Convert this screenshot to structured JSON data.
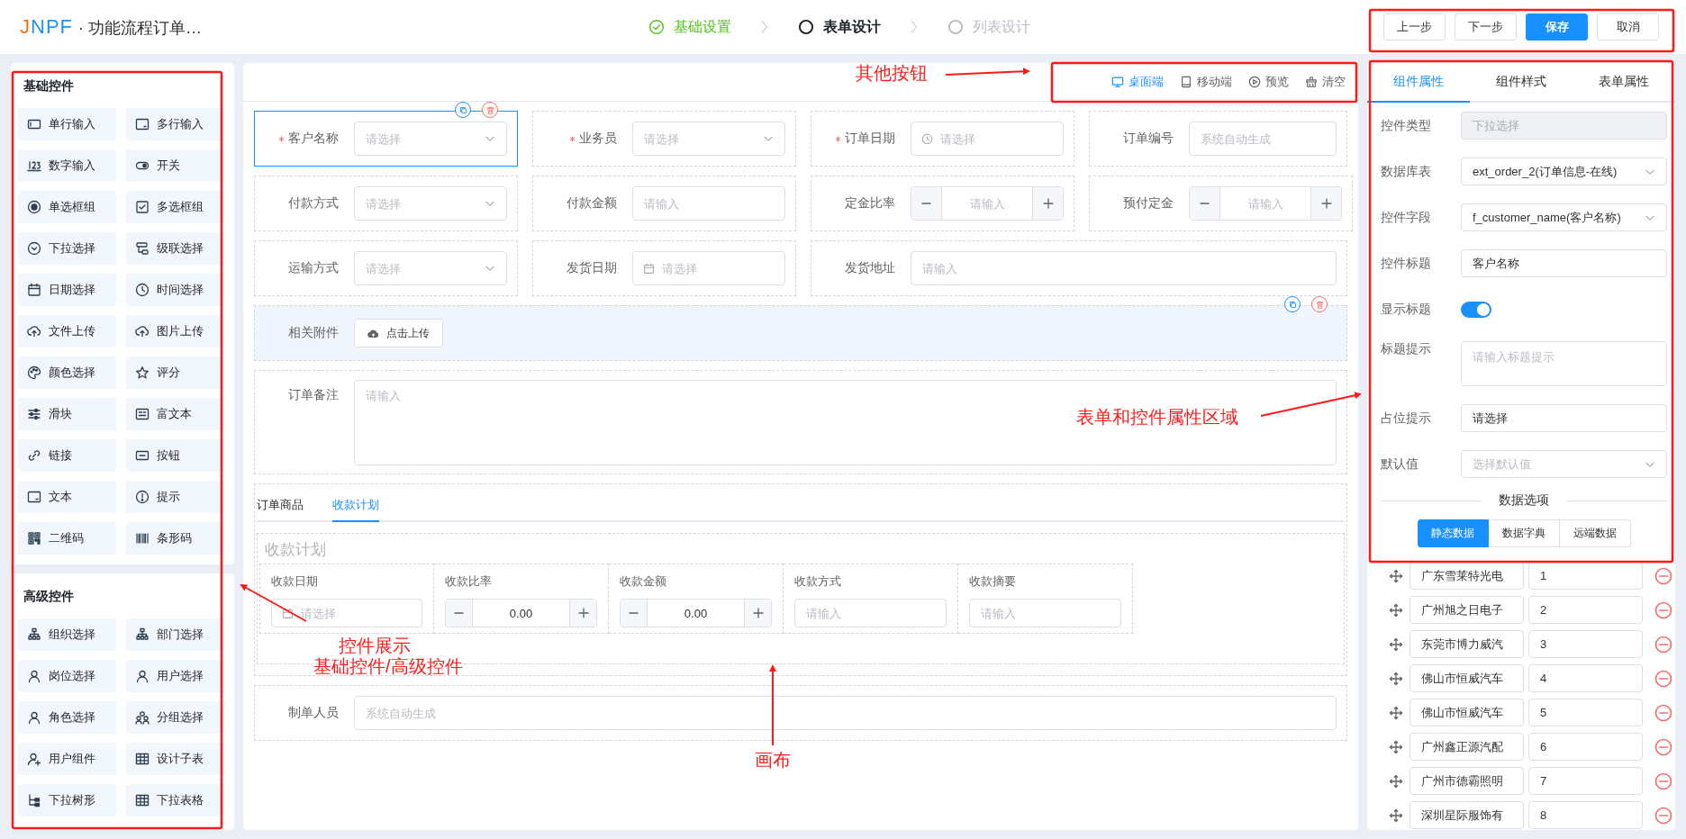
{
  "app": {
    "logo": "JNPF",
    "title": "· 功能流程订单…"
  },
  "steps": [
    {
      "label": "基础设置",
      "done": true,
      "current": false
    },
    {
      "label": "表单设计",
      "done": false,
      "current": true
    },
    {
      "label": "列表设计",
      "done": false,
      "current": false
    }
  ],
  "header_buttons": [
    {
      "label": "上一步",
      "primary": false
    },
    {
      "label": "下一步",
      "primary": false
    },
    {
      "label": "保存",
      "primary": true
    },
    {
      "label": "取消",
      "primary": false
    }
  ],
  "palette": [
    {
      "title": "基础控件",
      "items": [
        "单行输入",
        "多行输入",
        "数字输入",
        "开关",
        "单选框组",
        "多选框组",
        "下拉选择",
        "级联选择",
        "日期选择",
        "时间选择",
        "文件上传",
        "图片上传",
        "颜色选择",
        "评分",
        "滑块",
        "富文本",
        "链接",
        "按钮",
        "文本",
        "提示",
        "二维码",
        "条形码"
      ]
    },
    {
      "title": "高级控件",
      "items": [
        "组织选择",
        "部门选择",
        "岗位选择",
        "用户选择",
        "角色选择",
        "分组选择",
        "用户组件",
        "设计子表",
        "下拉树形",
        "下拉表格"
      ]
    }
  ],
  "toolbar": [
    {
      "label": "桌面端",
      "selected": true
    },
    {
      "label": "移动端",
      "selected": false
    },
    {
      "label": "预览",
      "selected": false
    },
    {
      "label": "清空",
      "selected": false
    }
  ],
  "form": {
    "rows": [
      [
        {
          "label": "客户名称",
          "kind": "select",
          "placeholder": "请选择",
          "required": true,
          "selected": true,
          "hovered": false
        },
        {
          "label": "业务员",
          "kind": "select",
          "placeholder": "请选择",
          "required": true,
          "selected": false,
          "hovered": false
        },
        {
          "label": "订单日期",
          "kind": "time",
          "placeholder": "请选择",
          "required": true,
          "selected": false,
          "hovered": false
        },
        {
          "label": "订单编号",
          "kind": "input",
          "placeholder": "系统自动生成",
          "required": false,
          "selected": false,
          "hovered": false
        }
      ],
      [
        {
          "label": "付款方式",
          "kind": "select",
          "placeholder": "请选择",
          "required": false,
          "selected": false,
          "hovered": false
        },
        {
          "label": "付款金额",
          "kind": "input",
          "placeholder": "请输入",
          "required": false,
          "selected": false,
          "hovered": false
        },
        {
          "label": "定金比率",
          "kind": "stepper",
          "placeholder": "请输入",
          "required": false,
          "selected": false,
          "hovered": false
        },
        {
          "label": "预付定金",
          "kind": "stepper",
          "placeholder": "请输入",
          "required": false,
          "selected": false,
          "hovered": false
        }
      ],
      [
        {
          "label": "运输方式",
          "kind": "select",
          "placeholder": "请选择",
          "required": false,
          "selected": false,
          "hovered": false
        },
        {
          "label": "发货日期",
          "kind": "date",
          "placeholder": "请选择",
          "required": false,
          "selected": false,
          "hovered": false
        },
        {
          "label": "发货地址",
          "kind": "input",
          "placeholder": "请输入",
          "required": false,
          "selected": false,
          "hovered": false
        }
      ],
      [
        {
          "label": "相关附件",
          "kind": "upload",
          "button": "点击上传",
          "required": false,
          "selected": false,
          "hovered": true
        }
      ],
      [
        {
          "label": "订单备注",
          "kind": "textarea",
          "placeholder": "请输入",
          "required": false,
          "selected": false,
          "hovered": false
        }
      ]
    ],
    "tabs": [
      {
        "label": "订单商品",
        "selected": false
      },
      {
        "label": "收款计划",
        "selected": true
      }
    ],
    "subform": {
      "title": "收款计划",
      "columns": [
        {
          "label": "收款日期",
          "kind": "date",
          "placeholder": "请选择"
        },
        {
          "label": "收款比率",
          "kind": "stepper",
          "value": "0.00"
        },
        {
          "label": "收款金额",
          "kind": "stepper",
          "value": "0.00"
        },
        {
          "label": "收款方式",
          "kind": "input",
          "placeholder": "请输入"
        },
        {
          "label": "收款摘要",
          "kind": "input",
          "placeholder": "请输入"
        }
      ]
    },
    "footer_rows": [
      {
        "label": "制单人员",
        "kind": "input",
        "placeholder": "系统自动生成",
        "required": false,
        "selected": false,
        "hovered": false
      }
    ]
  },
  "properties": {
    "tabs": [
      {
        "label": "组件属性",
        "selected": true
      },
      {
        "label": "组件样式",
        "selected": false
      },
      {
        "label": "表单属性",
        "selected": false
      }
    ],
    "fields": [
      {
        "label": "控件类型",
        "kind": "input",
        "value": "下拉选择",
        "disabled": true
      },
      {
        "label": "数据库表",
        "kind": "select",
        "value": "ext_order_2(订单信息-在线)",
        "disabled": false
      },
      {
        "label": "控件字段",
        "kind": "select",
        "value": "f_customer_name(客户名称)",
        "disabled": false
      },
      {
        "label": "控件标题",
        "kind": "input",
        "value": "客户名称",
        "disabled": false
      },
      {
        "label": "显示标题",
        "kind": "switch",
        "on": true,
        "disabled": false
      },
      {
        "label": "标题提示",
        "kind": "textarea",
        "placeholder": "请输入标题提示",
        "disabled": false
      },
      {
        "label": "占位提示",
        "kind": "input",
        "value": "请选择",
        "disabled": false
      },
      {
        "label": "默认值",
        "kind": "select",
        "placeholder": "选择默认值",
        "disabled": false
      }
    ],
    "section": "数据选项",
    "source_buttons": [
      {
        "label": "静态数据",
        "selected": true
      },
      {
        "label": "数据字典",
        "selected": false
      },
      {
        "label": "远端数据",
        "selected": false
      }
    ],
    "options": [
      {
        "label": "广东雪莱特光电",
        "value": "1"
      },
      {
        "label": "广州旭之日电子",
        "value": "2"
      },
      {
        "label": "东莞市博力威汽",
        "value": "3"
      },
      {
        "label": "佛山市恒威汽车",
        "value": "4"
      },
      {
        "label": "佛山市恒威汽车",
        "value": "5"
      },
      {
        "label": "广州鑫正源汽配",
        "value": "6"
      },
      {
        "label": "广州市德霸照明",
        "value": "7"
      },
      {
        "label": "深圳星际服饰有",
        "value": "8"
      }
    ]
  },
  "annotations": [
    {
      "lines": [
        "其他按钮"
      ]
    },
    {
      "lines": [
        "表单和控件属性区域"
      ]
    },
    {
      "lines": [
        "控件展示",
        "基础控件/高级控件"
      ]
    },
    {
      "lines": [
        "画布"
      ]
    }
  ]
}
